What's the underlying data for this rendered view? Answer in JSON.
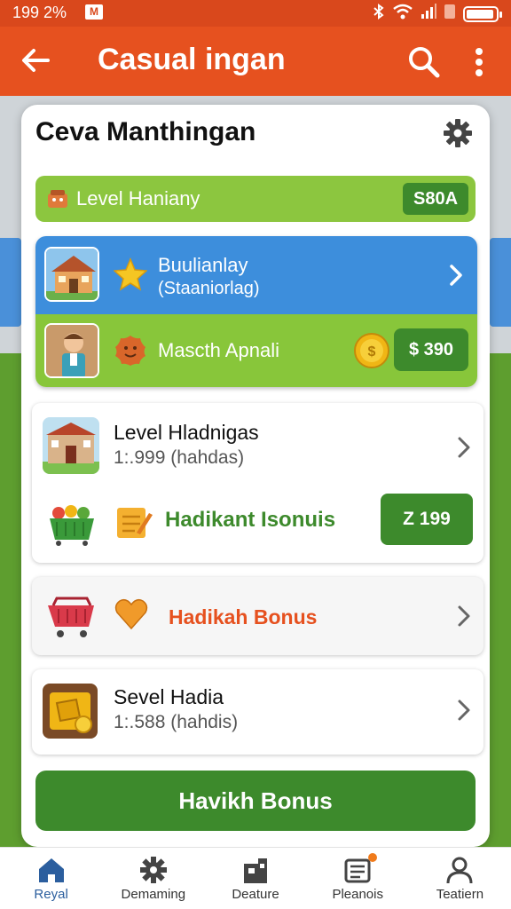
{
  "status_bar": {
    "time": "199 2%",
    "notif_label": "M"
  },
  "app_bar": {
    "title": "Casual ingan"
  },
  "card": {
    "title": "Ceva Manthingan"
  },
  "level_bar": {
    "label": "Level Haniany",
    "value": "S80A"
  },
  "featured": {
    "top_title": "Buulianlay",
    "top_sub": "(Staaniorlag)",
    "bottom_title": "Mascth Apnali",
    "bottom_price": "$ 390"
  },
  "list": {
    "item1": {
      "title": "Level Hladnigas",
      "sub": "1:.999 (hahdas)",
      "promo": "Hadikant Isonuis",
      "price": "Z 199"
    },
    "item2": {
      "promo": "Hadikah Bonus"
    },
    "item3": {
      "title": "Sevel Hadia",
      "sub": "1:.588 (hahdis)"
    }
  },
  "bonus_button": {
    "label": "Havikh Bonus"
  },
  "bottom_nav": [
    {
      "label": "Reyal",
      "icon": "home-icon"
    },
    {
      "label": "Demaming",
      "icon": "gear-icon"
    },
    {
      "label": "Deature",
      "icon": "store-icon"
    },
    {
      "label": "Pleanois",
      "icon": "list-icon"
    },
    {
      "label": "Teatiern",
      "icon": "profile-icon"
    }
  ],
  "colors": {
    "accent": "#e6511f",
    "green": "#3d8a2c",
    "lime": "#8cc63f",
    "blue": "#3d8edc"
  }
}
